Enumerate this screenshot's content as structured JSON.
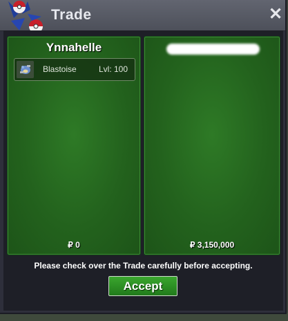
{
  "window": {
    "title": "Trade",
    "close_icon": "close-icon"
  },
  "left_panel": {
    "player_name": "Ynnahelle",
    "items": [
      {
        "name": "Blastoise",
        "level": "Lvl: 100",
        "icon": "pokemon-sprite-icon"
      }
    ],
    "money": "₽ 0"
  },
  "right_panel": {
    "player_name_redacted": true,
    "money": "₽ 3,150,000"
  },
  "notice": "Please check over the Trade carefully before accepting.",
  "accept_label": "Accept",
  "colors": {
    "panel_green": "#23621d",
    "accept_green": "#2d9425",
    "window_bg": "#2e2f3b"
  }
}
